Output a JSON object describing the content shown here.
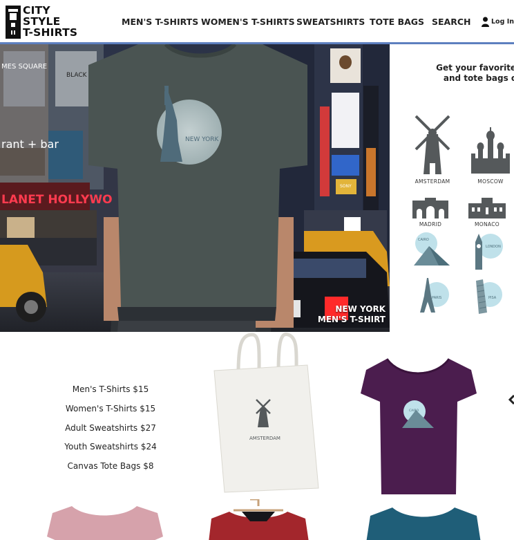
{
  "logo": {
    "line1": "CITY",
    "line2": "STYLE",
    "line3": "T-SHIRTS"
  },
  "nav": [
    {
      "label": "MEN'S T-SHIRTS"
    },
    {
      "label": "WOMEN'S T-SHIRTS"
    },
    {
      "label": "SWEATSHIRTS"
    },
    {
      "label": "TOTE BAGS"
    },
    {
      "label": "SEARCH"
    }
  ],
  "login": {
    "label": "Log In",
    "icon": "user-icon"
  },
  "hero": {
    "shirt_print": "NEW YORK",
    "caption_line1": "NEW YORK",
    "caption_line2": "MEN'S T-SHIRT",
    "signs": {
      "sign1": "LANET HOLLYWO",
      "sign2": "rant + bar",
      "sign3": "MES SQUARE",
      "sign4": "BLACK",
      "sign5": "SONY"
    }
  },
  "side": {
    "tagline_line1": "Get your favorite city d",
    "tagline_line2": "and tote bags of ma",
    "cities": [
      {
        "name": "AMSTERDAM",
        "icon": "windmill-icon"
      },
      {
        "name": "MOSCOW",
        "icon": "cathedral-icon"
      },
      {
        "name": "MADRID",
        "icon": "gate-icon"
      },
      {
        "name": "MONACO",
        "icon": "palace-icon"
      },
      {
        "name": "CAIRO",
        "icon": "pyramid-icon"
      },
      {
        "name": "LONDON",
        "icon": "big-ben-icon"
      },
      {
        "name": "PARIS",
        "icon": "eiffel-tower-icon"
      },
      {
        "name": "PISA",
        "icon": "leaning-tower-icon"
      }
    ]
  },
  "prices": [
    "Men's T-Shirts $15",
    "Women's T-Shirts $15",
    "Adult Sweatshirts $27",
    "Youth Sweatshirts $24",
    "Canvas Tote Bags $8"
  ],
  "products": {
    "tote_label": "AMSTERDAM",
    "purple_shirt_label": "CAIRO"
  },
  "colors": {
    "nav_rule": "#5d7fbf",
    "shirt_charcoal": "#4a5452",
    "shirt_purple": "#4b1d4e",
    "shirt_pink": "#d6a2ab",
    "shirt_red": "#a3262c",
    "shirt_teal": "#1f5e78",
    "icon_gray": "#55595b",
    "icon_blue": "#bfe1ea"
  }
}
